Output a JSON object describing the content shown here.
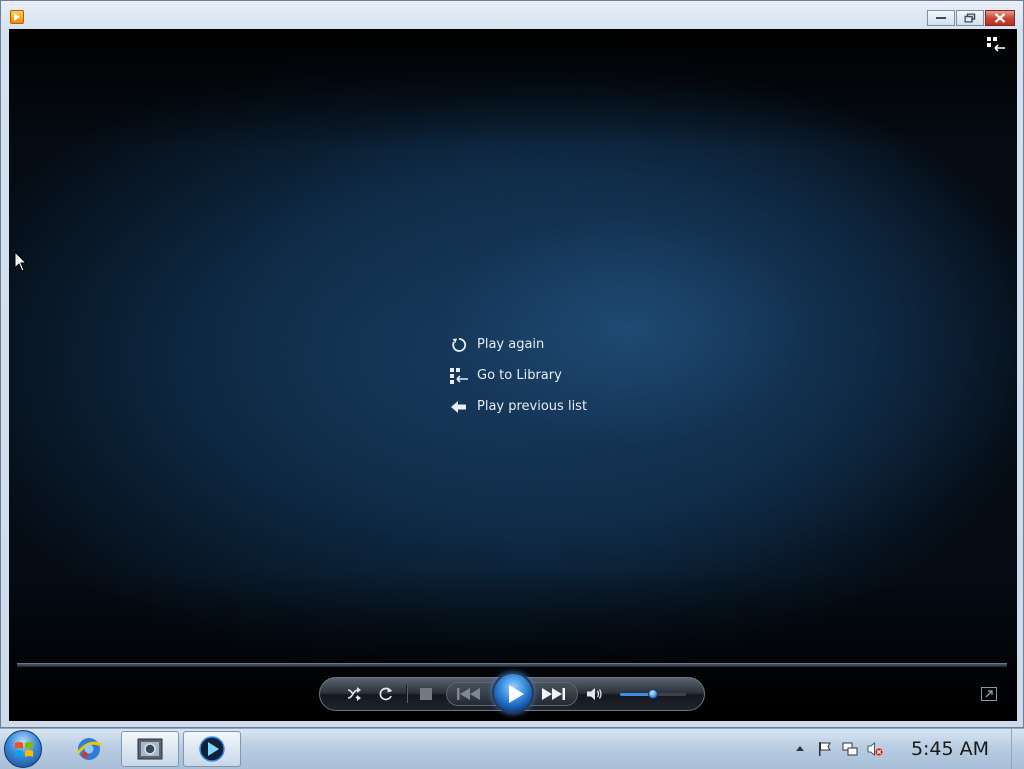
{
  "window": {
    "title": "",
    "caption_buttons": [
      "minimize",
      "restore",
      "close"
    ]
  },
  "player": {
    "end_menu": [
      {
        "label": "Play again",
        "icon": "replay-icon"
      },
      {
        "label": "Go to Library",
        "icon": "library-icon"
      },
      {
        "label": "Play previous list",
        "icon": "back-arrow-icon"
      }
    ],
    "controls": {
      "shuffle": "shuffle-icon",
      "repeat": "repeat-icon",
      "stop": "stop-icon",
      "previous": "previous-icon",
      "play": "play-icon",
      "next": "next-icon",
      "mute": "speaker-icon",
      "volume_level": 0.5
    },
    "seek_progress": 0
  },
  "taskbar": {
    "clock": "5:45 AM",
    "tray_icons": [
      "show-hidden-icons",
      "action-center-flag-icon",
      "network-icon",
      "volume-muted-icon"
    ],
    "pinned": [
      "internet-explorer-icon",
      "windows-explorer-icon",
      "media-player-icon"
    ]
  },
  "colors": {
    "accent": "#3a8ee8",
    "background_dark": "#03070c",
    "menu_text": "#e6edf5"
  }
}
